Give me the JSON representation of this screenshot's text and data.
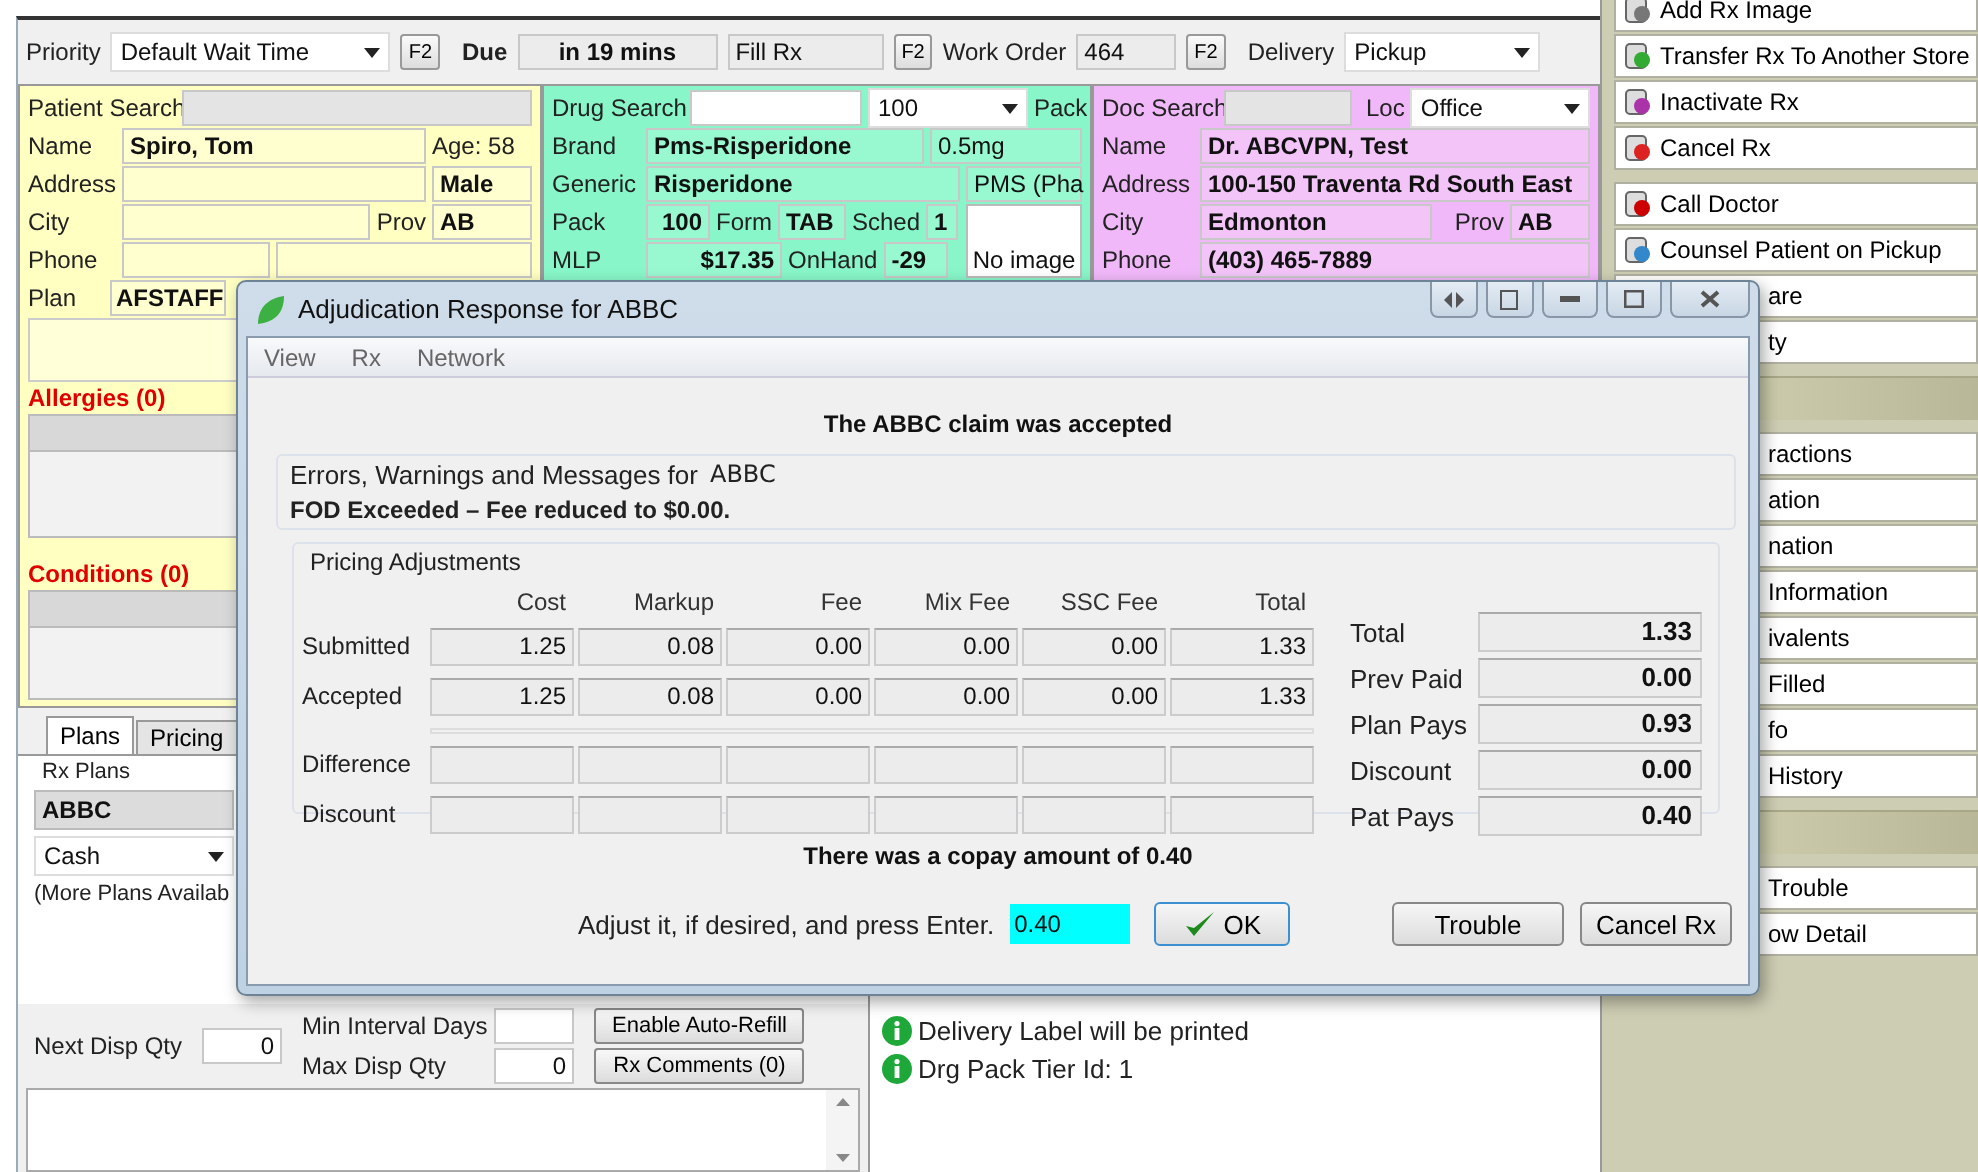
{
  "top_bar": {
    "priority_label": "Priority",
    "priority": "Default Wait Time",
    "due_label": "Due",
    "due": "in 19 mins",
    "fill": "Fill Rx",
    "work_order_label": "Work Order",
    "work_order": "464",
    "delivery_label": "Delivery",
    "delivery": "Pickup",
    "keys": [
      "F2",
      "F2",
      "F2"
    ]
  },
  "patient": {
    "search_label": "Patient Search",
    "name_label": "Name",
    "name": "Spiro, Tom",
    "age": "Age: 58",
    "address_label": "Address",
    "sex": "Male",
    "city_label": "City",
    "prov_label": "Prov",
    "prov": "AB",
    "phone_label": "Phone",
    "plan_label": "Plan",
    "plan": "AFSTAFF",
    "allergies": "Allergies (0)",
    "conditions": "Conditions (0)"
  },
  "drug": {
    "search_label": "Drug Search",
    "qty": "100",
    "pack_label": "Pack",
    "brand_label": "Brand",
    "brand": "Pms-Risperidone",
    "strength": "0.5mg",
    "generic_label": "Generic",
    "generic": "Risperidone",
    "maker": "PMS (Pha",
    "pack_row_label": "Pack",
    "pack": "100",
    "form_label": "Form",
    "form": "TAB",
    "sched_label": "Sched",
    "sched": "1",
    "mlp_label": "MLP",
    "mlp": "$17.35",
    "onhand_label": "OnHand",
    "onhand": "-29",
    "image": "No image"
  },
  "doctor": {
    "search_label": "Doc Search",
    "loc_label": "Loc",
    "loc": "Office",
    "name_label": "Name",
    "name": "Dr. ABCVPN, Test",
    "address_label": "Address",
    "address": "100-150 Traventa Rd South East",
    "city_label": "City",
    "city": "Edmonton",
    "prov_label": "Prov",
    "prov": "AB",
    "phone_label": "Phone",
    "phone": "(403) 465-7889"
  },
  "tabs": [
    {
      "label": "Plans",
      "selected": true
    },
    {
      "label": "Pricing",
      "selected": false
    }
  ],
  "plans": {
    "heading": "Rx Plans",
    "items": [
      "ABBC"
    ],
    "payment": "Cash",
    "more": "(More Plans Availab"
  },
  "refill": {
    "next_label": "Next Disp Qty",
    "next": "0",
    "min_label": "Min Interval Days",
    "max_label": "Max Disp Qty",
    "max": "0",
    "buttons": [
      "Enable Auto-Refill",
      "Rx Comments (0)"
    ]
  },
  "messages": [
    "Delivery Label will be printed",
    "Drg Pack Tier Id: 1"
  ],
  "action_groups": [
    [
      {
        "label": "Add Rx Image",
        "kind": "image"
      },
      {
        "label": "Transfer Rx To Another Store",
        "kind": "transfer"
      },
      {
        "label": "Inactivate Rx",
        "kind": "inactivate"
      },
      {
        "label": "Cancel Rx",
        "kind": "cancel"
      }
    ],
    [
      {
        "label": "Call Doctor",
        "kind": "doctor"
      },
      {
        "label": "Counsel Patient on Pickup",
        "kind": "counsel"
      },
      {
        "label": "are",
        "kind": "covered"
      },
      {
        "label": "ty",
        "kind": "covered"
      }
    ],
    [
      {
        "label": "ractions",
        "kind": "covered"
      },
      {
        "label": "ation",
        "kind": "covered"
      },
      {
        "label": "nation",
        "kind": "covered"
      },
      {
        "label": "Information",
        "kind": "covered"
      },
      {
        "label": "ivalents",
        "kind": "covered"
      },
      {
        "label": "Filled",
        "kind": "covered"
      },
      {
        "label": "fo",
        "kind": "covered"
      },
      {
        "label": "History",
        "kind": "covered"
      }
    ],
    [
      {
        "label": "Trouble",
        "kind": "covered"
      },
      {
        "label": "ow Detail",
        "kind": "covered"
      }
    ]
  ],
  "dialog": {
    "title": "Adjudication Response for ABBC",
    "menu": [
      "View",
      "Rx",
      "Network"
    ],
    "status": "The ABBC claim was accepted",
    "messages_label": "Errors, Warnings and Messages for",
    "messages_plan": "ABBC",
    "message": "FOD Exceeded – Fee reduced to $0.00.",
    "pricing": {
      "title": "Pricing Adjustments",
      "columns": [
        "Cost",
        "Markup",
        "Fee",
        "Mix Fee",
        "SSC Fee",
        "Total"
      ],
      "rows": [
        {
          "label": "Submitted",
          "values": [
            "1.25",
            "0.08",
            "0.00",
            "0.00",
            "0.00",
            "1.33"
          ]
        },
        {
          "label": "Accepted",
          "values": [
            "1.25",
            "0.08",
            "0.00",
            "0.00",
            "0.00",
            "1.33"
          ]
        },
        {
          "label": "Difference"
        },
        {
          "label": "Discount"
        }
      ]
    },
    "summary": [
      {
        "label": "Total",
        "value": "1.33"
      },
      {
        "label": "Prev Paid",
        "value": "0.00"
      },
      {
        "label": "Plan Pays",
        "value": "0.93"
      },
      {
        "label": "Discount",
        "value": "0.00"
      },
      {
        "label": "Pat Pays",
        "value": "0.40"
      }
    ],
    "copay": "There was a copay amount of 0.40",
    "adjust_label": "Adjust it, if desired, and press Enter.",
    "adjust_value": "0.40",
    "buttons": [
      {
        "label": "OK",
        "kind": "ok"
      },
      {
        "label": "Trouble",
        "kind": "plain"
      },
      {
        "label": "Cancel Rx",
        "kind": "plain"
      }
    ]
  }
}
